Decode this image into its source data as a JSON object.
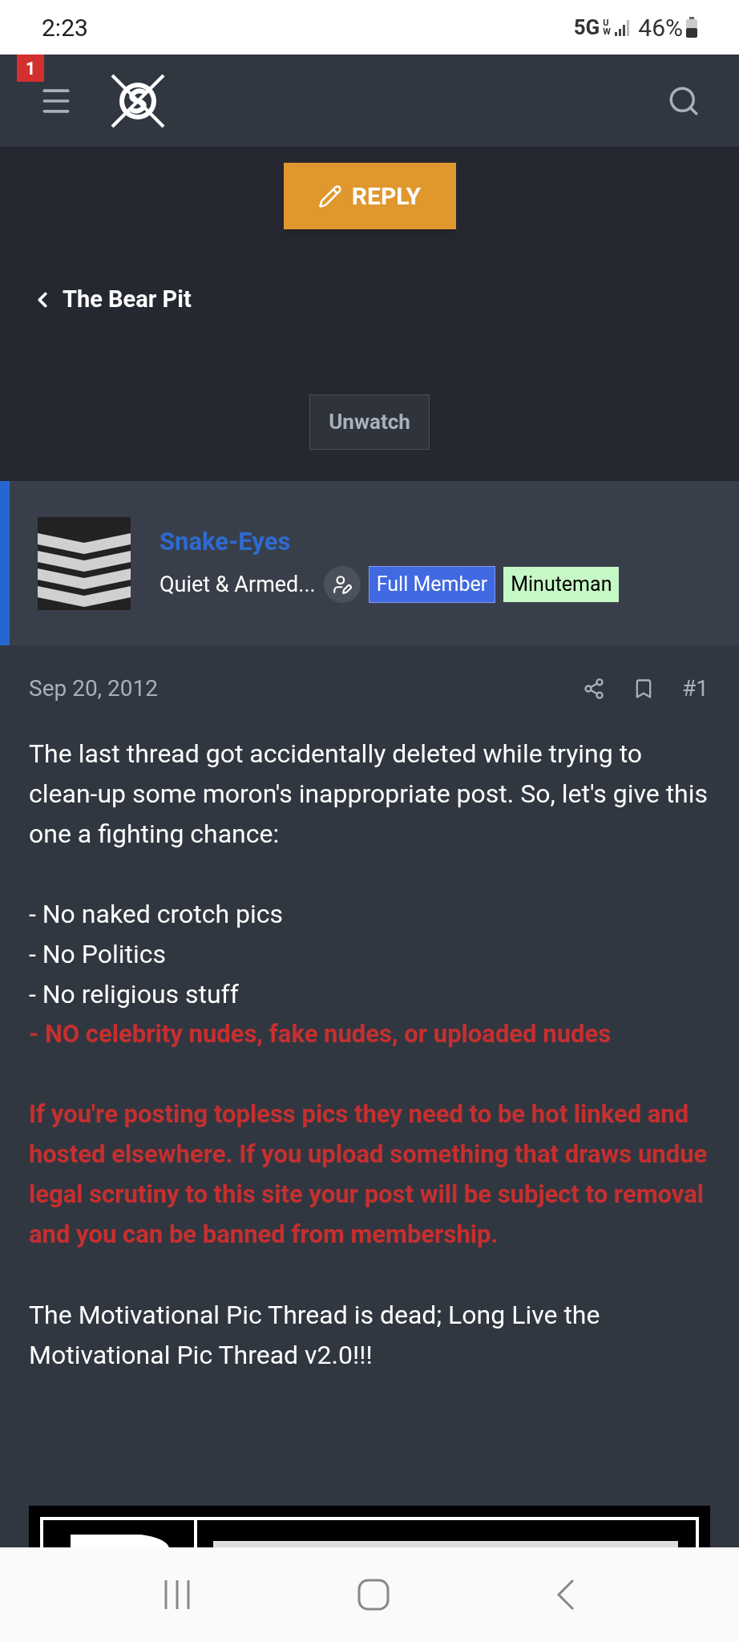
{
  "status_bar": {
    "time": "2:23",
    "network": "5G",
    "network_sub": "UW",
    "battery": "46%"
  },
  "header": {
    "notification_count": "1"
  },
  "reply_button": "REPLY",
  "breadcrumb": "The Bear Pit",
  "watch_button": "Unwatch",
  "author": {
    "name": "Snake-Eyes",
    "title": "Quiet & Armed...",
    "badges": [
      {
        "label": "Full Member",
        "color": "#4169e1"
      },
      {
        "label": "Minuteman",
        "color": "#c6f7c6"
      }
    ]
  },
  "post": {
    "date": "Sep 20, 2012",
    "number": "#1",
    "sections": [
      [
        {
          "text": "The last thread got accidentally deleted while trying to clean-up some moron's inappropriate post. So, let's give this one a fighting chance:",
          "warning": false
        }
      ],
      [
        {
          "text": "- No naked crotch pics",
          "warning": false
        },
        {
          "text": "- No Politics",
          "warning": false
        },
        {
          "text": "- No religious stuff",
          "warning": false
        },
        {
          "text": "- NO celebrity nudes, fake nudes, or uploaded nudes",
          "warning": true
        }
      ],
      [
        {
          "text": "If you're posting topless pics they need to be hot linked and hosted elsewhere. If you upload something that draws undue legal scrutiny to this site your post will be subject to removal and you can be banned from membership.",
          "warning": true
        }
      ],
      [
        {
          "text": "The Motivational Pic Thread is dead; Long Live the Motivational Pic Thread v2.0!!!",
          "warning": false
        }
      ]
    ]
  }
}
